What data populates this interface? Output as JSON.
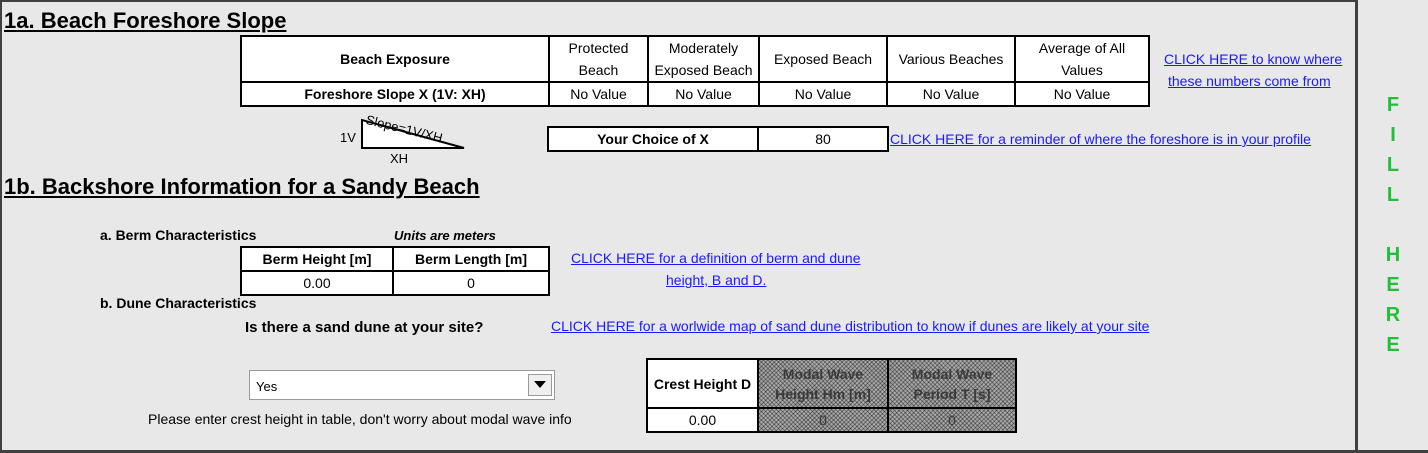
{
  "section1a": {
    "title": "1a. Beach Foreshore Slope",
    "table": {
      "header_label": "Beach Exposure",
      "columns": [
        "Protected Beach",
        "Moderately Exposed Beach",
        "Exposed Beach",
        "Various Beaches",
        "Average of All Values"
      ],
      "row_label": "Foreshore Slope X (1V: XH)",
      "values": [
        "No Value",
        "No Value",
        "No Value",
        "No Value",
        "No Value"
      ]
    },
    "link_numbers_line1": "CLICK HERE to know where",
    "link_numbers_line2": "these numbers come from",
    "diagram": {
      "slope_text": "Slope=1V/XH",
      "v_label": "1V",
      "h_label": "XH"
    },
    "choice_label": "Your Choice of X",
    "choice_value": "80",
    "link_foreshore": "CLICK HERE for a reminder of where the foreshore is in your profile"
  },
  "section1b": {
    "title": "1b. Backshore Information for a Sandy Beach",
    "berm": {
      "label": "a. Berm Characteristics",
      "units_note": "Units are meters",
      "headers": [
        "Berm Height [m]",
        "Berm Length [m]"
      ],
      "values": [
        "0.00",
        "0"
      ],
      "link_line1": "CLICK HERE for a definition of berm and dune",
      "link_line2": "height, B and D."
    },
    "dune": {
      "label": "b. Dune Characteristics",
      "question": "Is there a sand dune at your site?",
      "link_map": "CLICK HERE for a worlwide map of sand dune distribution to know if dunes are likely at your site",
      "dropdown_value": "Yes",
      "note": "Please enter crest height in table, don't worry about modal wave info",
      "table": {
        "crest_header": "Crest Height D",
        "crest_value": "0.00",
        "hm_header_line1": "Modal Wave",
        "hm_header_line2": "Height Hm [m]",
        "hm_value": "0",
        "period_header_line1": "Modal Wave",
        "period_header_line2": "Period T [s]",
        "period_value": "0"
      }
    }
  },
  "sidebar": {
    "letters": [
      "F",
      "I",
      "L",
      "L",
      "H",
      "E",
      "R",
      "E"
    ],
    "color": "#1fbf3a"
  },
  "icons": {
    "dropdown": "chevron-down-icon"
  }
}
